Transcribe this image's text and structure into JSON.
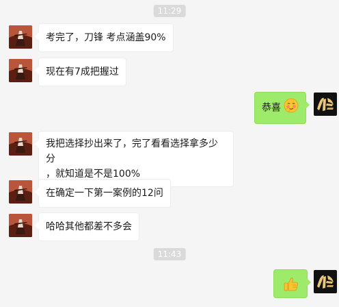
{
  "colors": {
    "background": "#f5f5f5",
    "timestamp_bg": "#dadada",
    "incoming_bubble": "#ffffff",
    "outgoing_bubble": "#9eea6a"
  },
  "timestamps": [
    "11:29",
    "11:43"
  ],
  "messages": [
    {
      "sender": "other",
      "text": "考完了，刀锋  考点涵盖90%"
    },
    {
      "sender": "other",
      "text": "现在有7成把握过"
    },
    {
      "sender": "me",
      "text": "恭喜",
      "emoji": "blushing-smile-emoji"
    },
    {
      "sender": "other",
      "text_line1": "我把选择抄出来了，完了看看选择拿多少分",
      "text_line2": "，就知道是不是100%"
    },
    {
      "sender": "other",
      "text": "在确定一下第一案例的12问"
    },
    {
      "sender": "other",
      "text": "哈哈其他都差不多会"
    },
    {
      "sender": "me",
      "emoji": "thumbs-up-emoji"
    }
  ]
}
